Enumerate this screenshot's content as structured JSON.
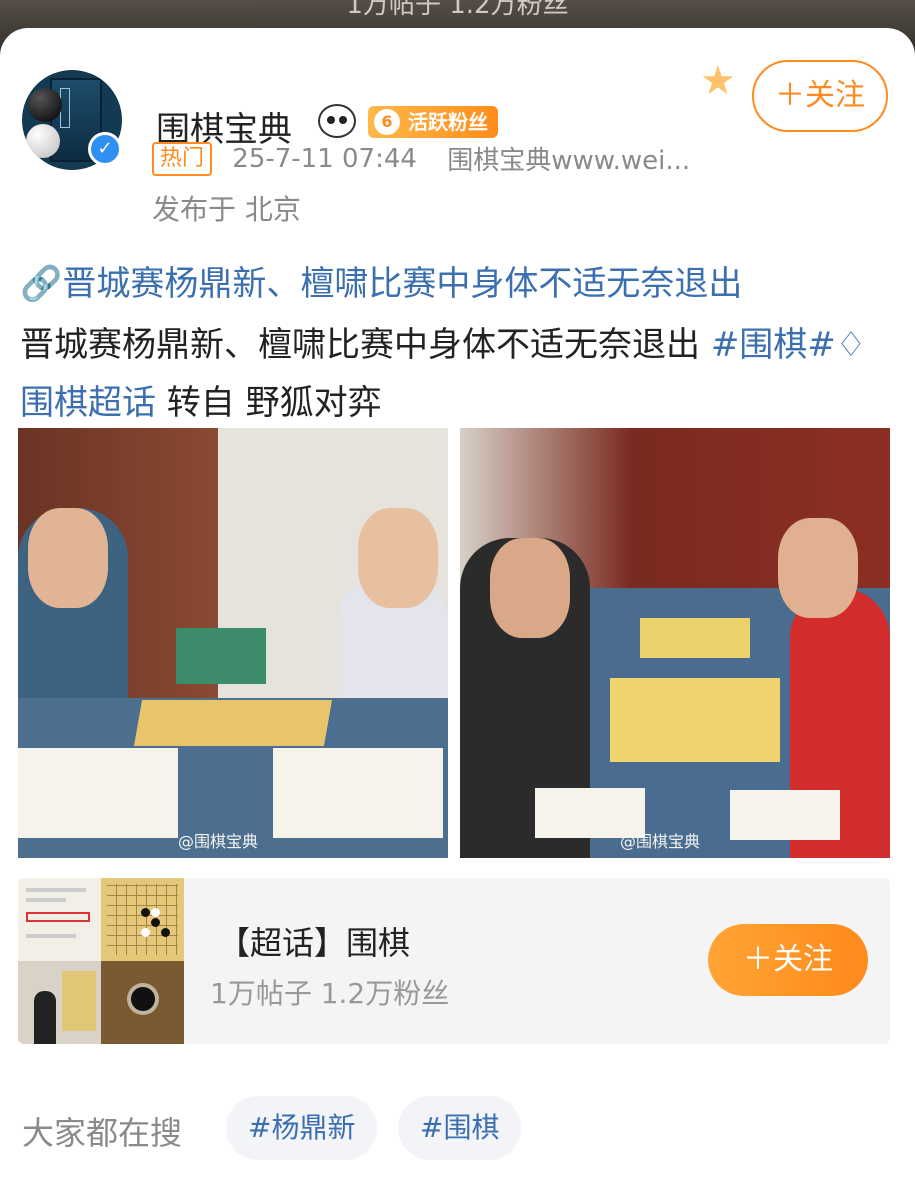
{
  "top_strip": {
    "text": "1万帖子 1.2万粉丝"
  },
  "post": {
    "username": "围棋宝典",
    "fan_badge": {
      "level": "6",
      "label": "活跃粉丝"
    },
    "follow_label": "＋关注",
    "hot_tag": "热门",
    "time": "25-7-11 07:44",
    "source": "围棋宝典www.wei...",
    "location": "发布于 北京",
    "link_title": "晋城赛杨鼎新、檀啸比赛中身体不适无奈退出",
    "body_text": "晋城赛杨鼎新、檀啸比赛中身体不适无奈退出 ",
    "hashtag": "#围棋#",
    "super_topic_link": "围棋超话",
    "repost_text": " 转自 野狐对弈",
    "photos": [
      {
        "watermark": "@围棋宝典"
      },
      {
        "watermark": "@围棋宝典"
      }
    ]
  },
  "topic_card": {
    "title": "【超话】围棋",
    "stats": "1万帖子 1.2万粉丝",
    "follow_label": "＋关注"
  },
  "search": {
    "label": "大家都在搜",
    "tags": [
      "#杨鼎新",
      "#围棋"
    ]
  },
  "colors": {
    "accent_orange": "#ff8a1f",
    "link_blue": "#3b6fb0"
  }
}
